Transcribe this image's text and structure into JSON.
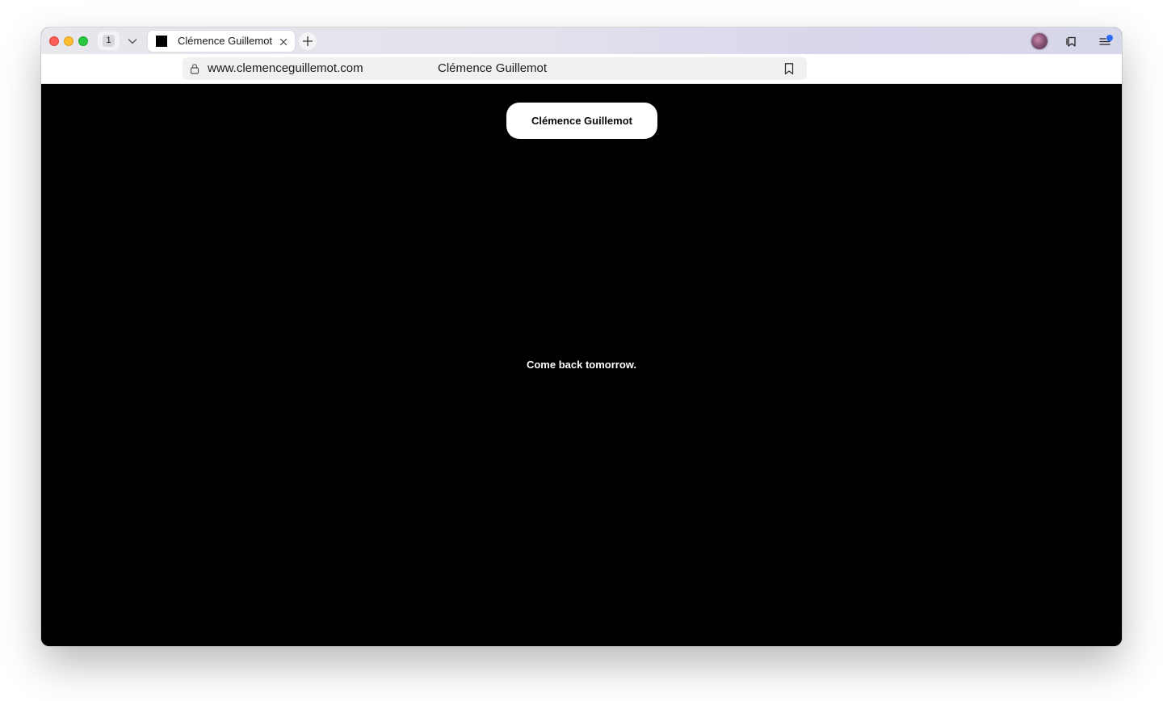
{
  "browser": {
    "tab_count": "1",
    "active_tab": {
      "title": "Clémence Guillemot",
      "favicon_color": "#000000"
    },
    "address_bar": {
      "url": "www.clemenceguillemot.com",
      "page_title": "Clémence Guillemot"
    },
    "icons": {
      "lock": "lock-icon",
      "bookmark": "bookmark-icon",
      "tab_overview": "tab-overview-icon",
      "sidebar": "sidebar-menu-icon",
      "new_tab": "plus-icon",
      "tab_close": "close-icon",
      "tab_dropdown": "chevron-down-icon"
    },
    "colors": {
      "close": "#fe5f57",
      "minimize": "#febc2e",
      "maximize": "#28c840",
      "notification_dot": "#2d6cf6"
    }
  },
  "page": {
    "background": "#000000",
    "name_button": "Clémence Guillemot",
    "message": "Come back tomorrow."
  }
}
